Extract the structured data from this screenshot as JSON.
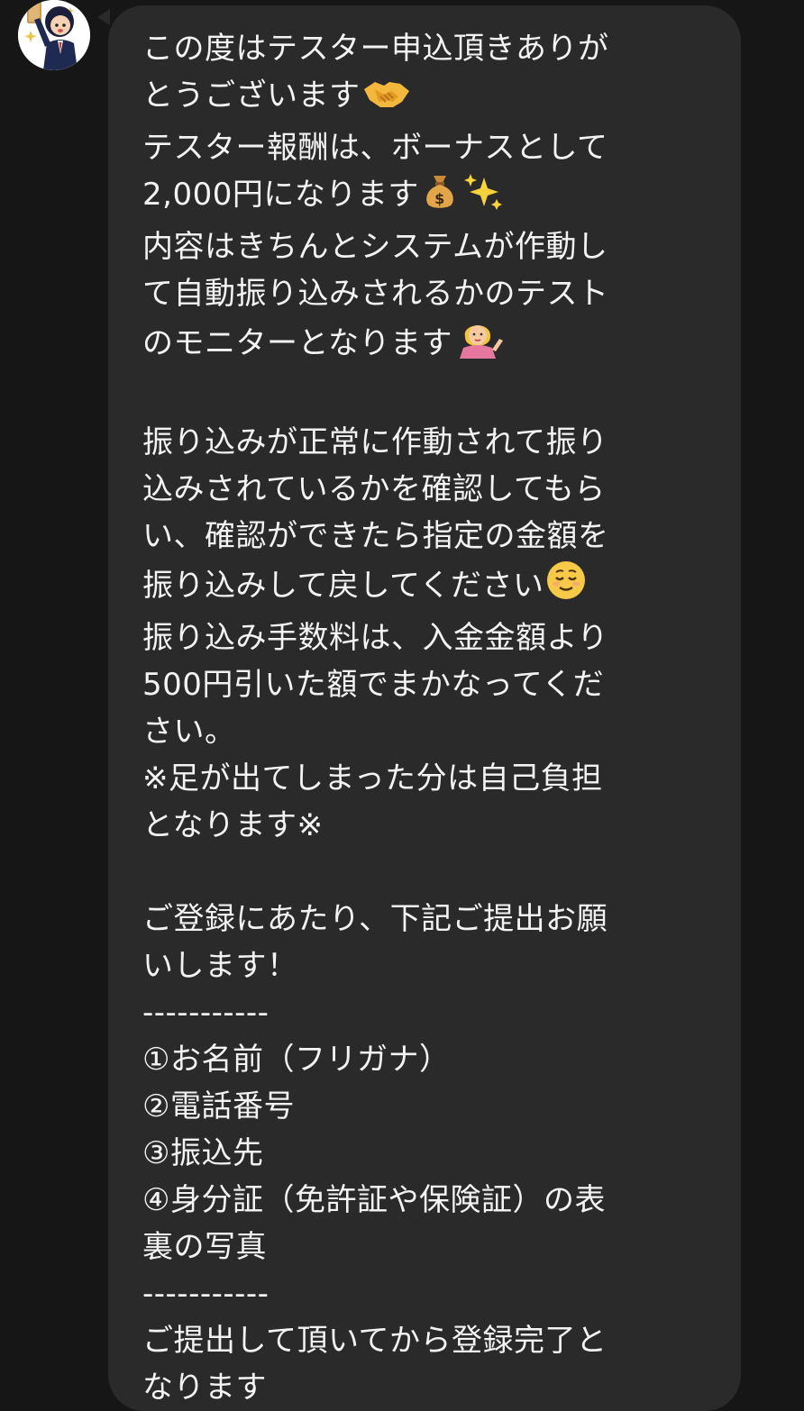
{
  "message": {
    "lines": [
      "この度はテスター申込頂きありが",
      "とうございます",
      "テスター報酬は、ボーナスとして",
      "2,000円になります",
      "内容はきちんとシステムが作動し",
      "て自動振り込みされるかのテスト",
      "のモニターとなります",
      "",
      "振り込みが正常に作動されて振り",
      "込みされているかを確認してもら",
      "い、確認ができたら指定の金額を",
      "振り込みして戻してください",
      "振り込み手数料は、入金金額より",
      "500円引いた額でまかなってくだ",
      "さい。",
      "※足が出てしまった分は自己負担",
      "となります※",
      "",
      "ご登録にあたり、下記ご提出お願",
      "いします！",
      "-----------",
      "①お名前（フリガナ）",
      "②電話番号",
      "③振込先",
      "④身分証（免許証や保険証）の表",
      "裏の写真",
      "-----------",
      "ご提出して頂いてから登録完了と",
      "なります"
    ],
    "emojis": {
      "handshake": "handshake-emoji",
      "money_bag": "money-bag-emoji",
      "sparkles": "sparkles-emoji",
      "person_tipping_hand": "person-tipping-hand-emoji",
      "relieved_face": "relieved-face-emoji"
    }
  },
  "colors": {
    "background": "#161616",
    "bubble": "#2a2a2a",
    "text": "#f3f3f3"
  }
}
